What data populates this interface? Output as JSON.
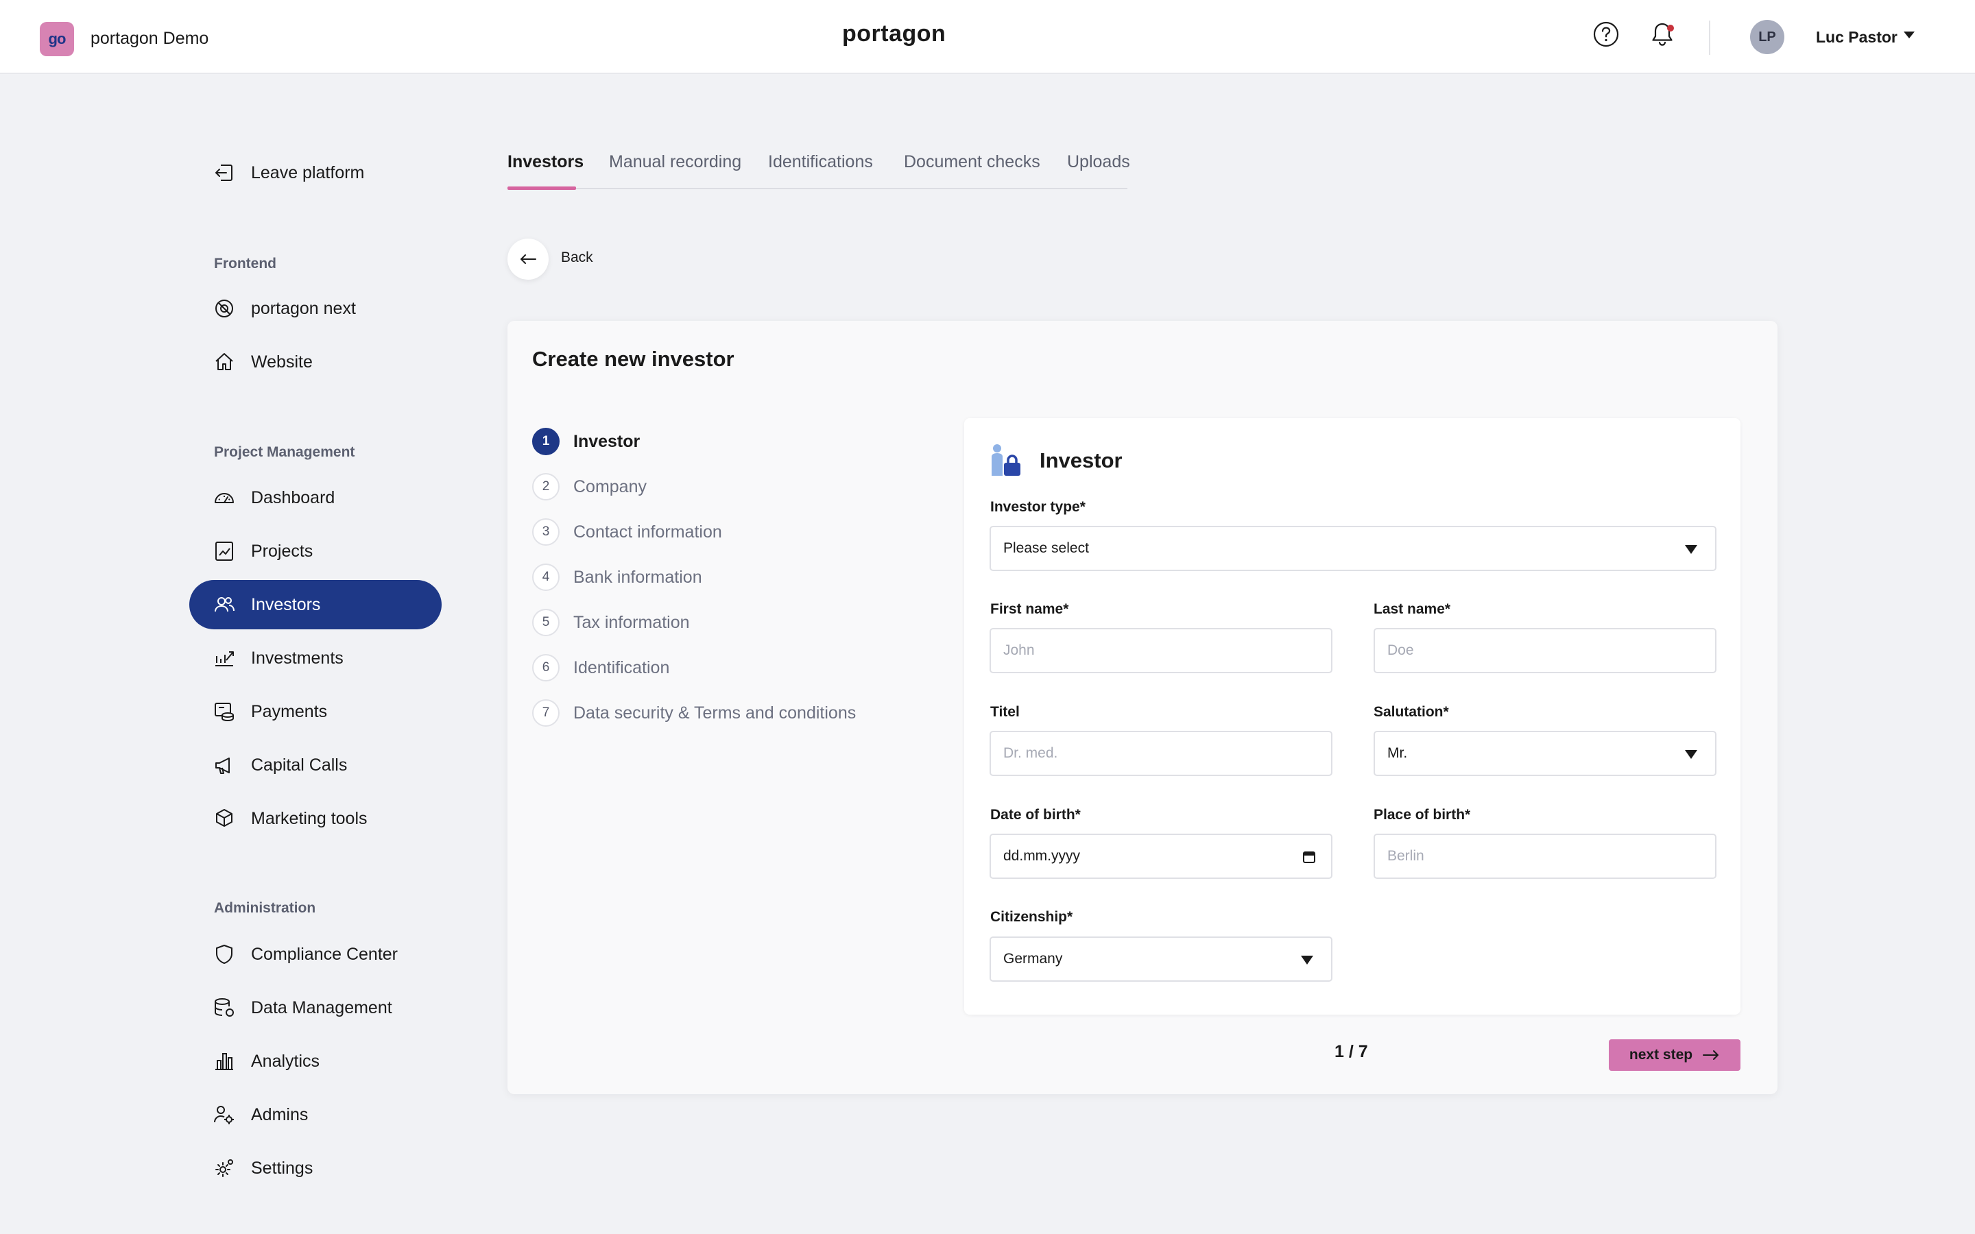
{
  "topbar": {
    "org_logo_text": "go",
    "org_name": "portagon Demo",
    "brand": "portagon",
    "user_initials": "LP",
    "user_name": "Luc Pastor"
  },
  "sidebar": {
    "leave_platform": "Leave platform",
    "sections": {
      "frontend": "Frontend",
      "project_management": "Project Management",
      "administration": "Administration"
    },
    "items": {
      "portagon_next": "portagon next",
      "website": "Website",
      "dashboard": "Dashboard",
      "projects": "Projects",
      "investors": "Investors",
      "investments": "Investments",
      "payments": "Payments",
      "capital_calls": "Capital Calls",
      "marketing_tools": "Marketing tools",
      "compliance_center": "Compliance Center",
      "data_management": "Data Management",
      "analytics": "Analytics",
      "admins": "Admins",
      "settings": "Settings"
    },
    "active_item": "investors"
  },
  "tabs": {
    "investors": "Investors",
    "manual_recording": "Manual recording",
    "identifications": "Identifications",
    "document_checks": "Document checks",
    "uploads": "Uploads",
    "active": "investors"
  },
  "back_label": "Back",
  "card": {
    "title": "Create new investor",
    "steps": [
      {
        "num": "1",
        "label": "Investor"
      },
      {
        "num": "2",
        "label": "Company"
      },
      {
        "num": "3",
        "label": "Contact information"
      },
      {
        "num": "4",
        "label": "Bank information"
      },
      {
        "num": "5",
        "label": "Tax information"
      },
      {
        "num": "6",
        "label": "Identification"
      },
      {
        "num": "7",
        "label": "Data security & Terms and conditions"
      }
    ],
    "active_step": 1,
    "form": {
      "title": "Investor",
      "investor_type": {
        "label": "Investor type*",
        "value": "Please select"
      },
      "first_name": {
        "label": "First name*",
        "placeholder": "John"
      },
      "last_name": {
        "label": "Last name*",
        "placeholder": "Doe"
      },
      "titel": {
        "label": "Titel",
        "placeholder": "Dr. med."
      },
      "salutation": {
        "label": "Salutation*",
        "value": "Mr."
      },
      "date_of_birth": {
        "label": "Date of birth*",
        "value": "dd.mm.yyyy"
      },
      "place_of_birth": {
        "label": "Place of birth*",
        "placeholder": "Berlin"
      },
      "citizenship": {
        "label": "Citizenship*",
        "value": "Germany"
      }
    },
    "pager": "1 / 7",
    "next_button": "next step"
  },
  "colors": {
    "primary_navy": "#1e3887",
    "accent_pink": "#d376b0",
    "tab_underline": "#d6649f",
    "background": "#f1f2f5"
  }
}
